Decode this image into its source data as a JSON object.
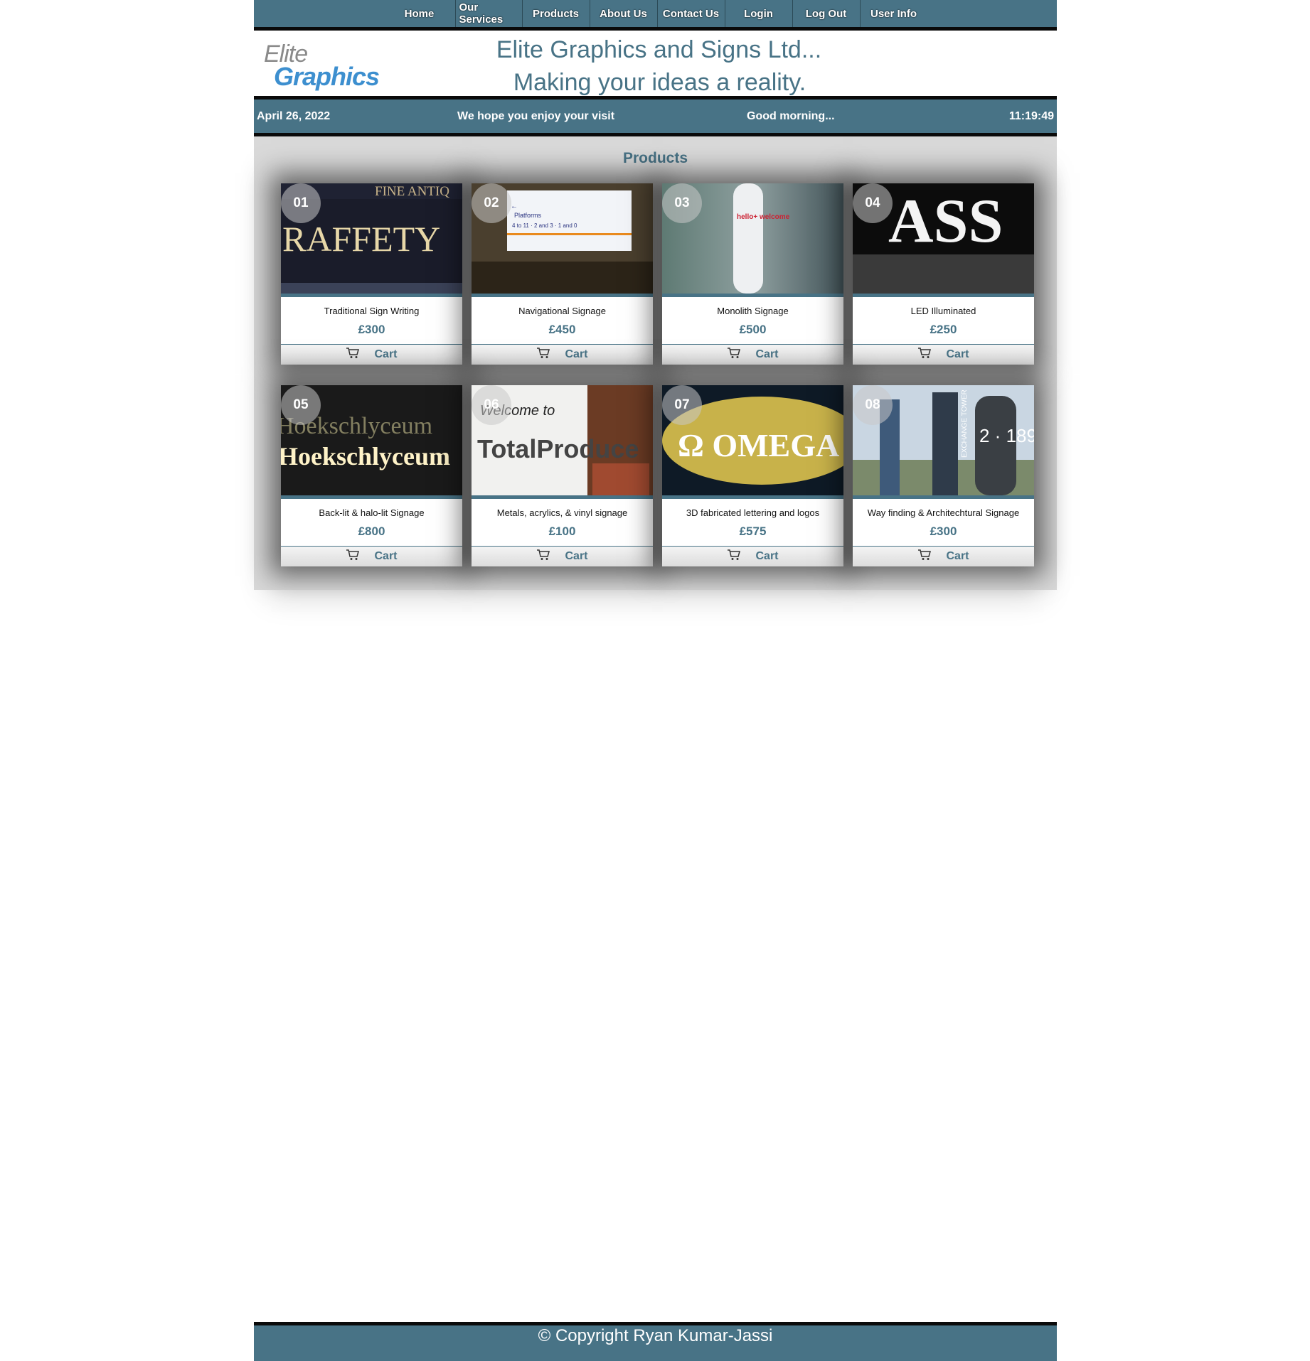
{
  "nav": {
    "items": [
      "Home",
      "Our Services",
      "Products",
      "About Us",
      "Contact Us",
      "Login",
      "Log Out",
      "User Info"
    ]
  },
  "header": {
    "logo_line1": "Elite",
    "logo_line2": "Graphics",
    "title_line1": "Elite Graphics and Signs Ltd...",
    "title_line2": "Making your ideas a reality."
  },
  "infobar": {
    "date": "April 26, 2022",
    "message": "We hope you enjoy your visit",
    "greeting": "Good morning...",
    "time": "11:19:49"
  },
  "products": {
    "heading": "Products",
    "cart_label": "Cart",
    "items": [
      {
        "num": "01",
        "name": "Traditional Sign Writing",
        "price": "£300",
        "image_text": "RAFFETY",
        "image_text2": "FINE ANTIQ"
      },
      {
        "num": "02",
        "name": "Navigational Signage",
        "price": "£450",
        "image_text": "Platforms",
        "image_text2": "4 to 11 · 2 and 3 · 1 and 0"
      },
      {
        "num": "03",
        "name": "Monolith Signage",
        "price": "£500",
        "image_text": "hello+ welcome",
        "image_text2": ""
      },
      {
        "num": "04",
        "name": "LED Illuminated",
        "price": "£250",
        "image_text": "ASS",
        "image_text2": ""
      },
      {
        "num": "05",
        "name": "Back-lit & halo-lit Signage",
        "price": "£800",
        "image_text": "Hoekschlyceum",
        "image_text2": ""
      },
      {
        "num": "06",
        "name": "Metals, acrylics, & vinyl signage",
        "price": "£100",
        "image_text": "TotalProduce",
        "image_text2": "Welcome to"
      },
      {
        "num": "07",
        "name": "3D fabricated lettering and logos",
        "price": "£575",
        "image_text": "Ω OMEGA",
        "image_text2": ""
      },
      {
        "num": "08",
        "name": "Way finding & Architechtural Signage",
        "price": "£300",
        "image_text": "EXCHANGE TOWER",
        "image_text2": "2 · 189"
      }
    ]
  },
  "footer": {
    "copyright": "© Copyright Ryan Kumar-Jassi"
  },
  "colors": {
    "brand": "#487386",
    "bar_border": "#0a0a0a",
    "panel_bg": "#d9d9d9",
    "logo_blue": "#3d8fcf"
  }
}
